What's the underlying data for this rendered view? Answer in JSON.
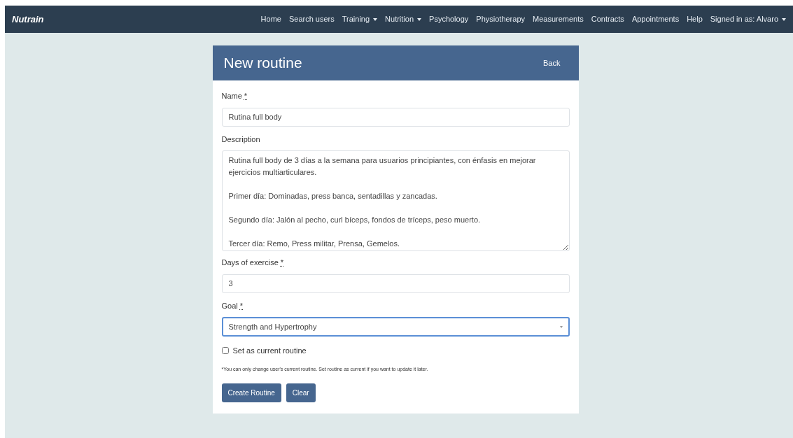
{
  "navbar": {
    "brand": "Nutrain",
    "items": [
      {
        "label": "Home",
        "dropdown": false
      },
      {
        "label": "Search users",
        "dropdown": false
      },
      {
        "label": "Training",
        "dropdown": true
      },
      {
        "label": "Nutrition",
        "dropdown": true
      },
      {
        "label": "Psychology",
        "dropdown": false
      },
      {
        "label": "Physiotherapy",
        "dropdown": false
      },
      {
        "label": "Measurements",
        "dropdown": false
      },
      {
        "label": "Contracts",
        "dropdown": false
      },
      {
        "label": "Appointments",
        "dropdown": false
      },
      {
        "label": "Help",
        "dropdown": false
      },
      {
        "label": "Signed in as: Alvaro",
        "dropdown": true
      }
    ]
  },
  "card": {
    "title": "New routine",
    "back": "Back",
    "fields": [
      {
        "kind": "input",
        "label": "Name",
        "required_mark": "*",
        "value": "Rutina full body",
        "focused": false
      },
      {
        "kind": "textarea",
        "label": "Description",
        "value": "Rutina full body de 3 días a la semana para usuarios principiantes, con énfasis en mejorar ejercicios multiarticulares.\n\nPrimer día: Dominadas, press banca, sentadillas y zancadas.\n\nSegundo día: Jalón al pecho, curl bíceps, fondos de tríceps, peso muerto.\n\nTercer día: Remo, Press militar, Prensa, Gemelos.",
        "focused": false
      },
      {
        "kind": "input",
        "label": "Days of exercise",
        "required_mark": "*",
        "value": "3",
        "focused": false
      },
      {
        "kind": "select",
        "label": "Goal",
        "required_mark": "*",
        "value": "Strength and Hypertrophy",
        "focused": true
      }
    ],
    "checkbox": {
      "label": "Set as current routine",
      "checked": false
    },
    "note": "*You can only change user's current routine. Set routine as current if you want to update it later.",
    "buttons": [
      "Create Routine",
      "Clear"
    ]
  }
}
